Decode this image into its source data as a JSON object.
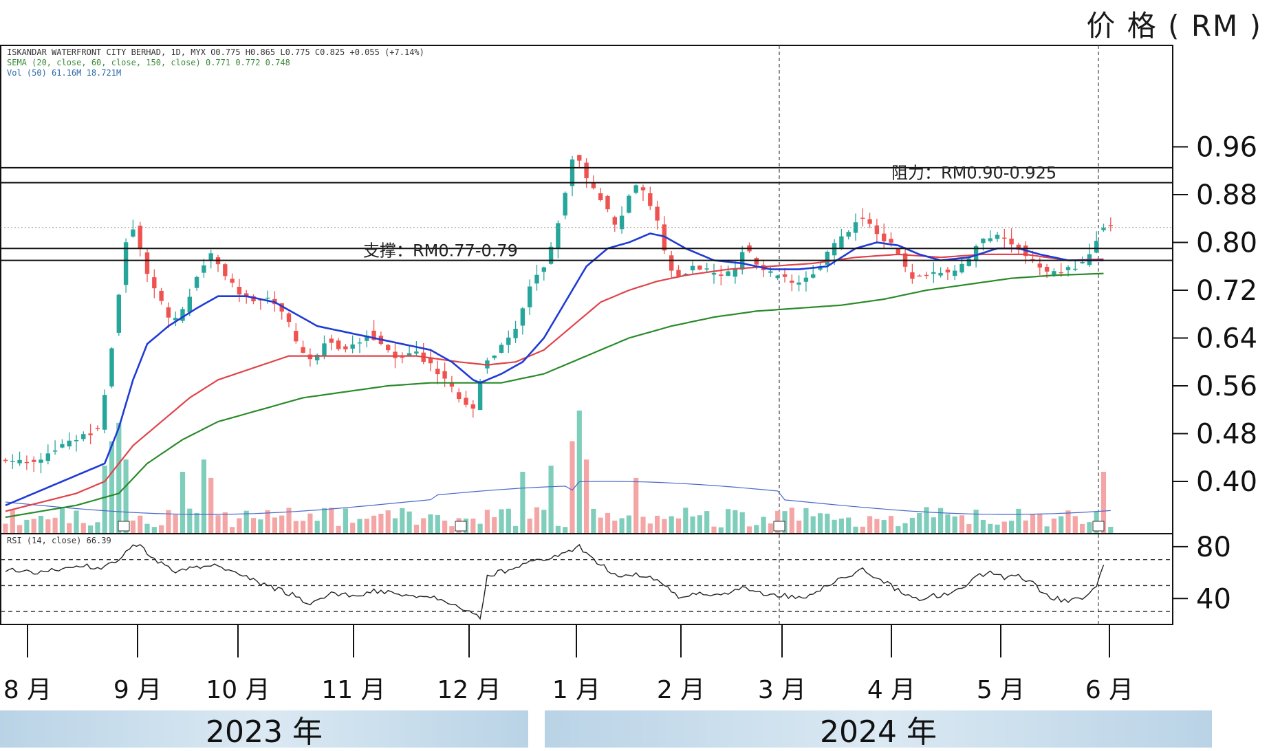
{
  "header": {
    "unit_title": "价 格 ( RM )"
  },
  "info": {
    "line1": "ISKANDAR WATERFRONT CITY BERHAD, 1D, MYX  O0.775  H0.865  L0.775  C0.825  +0.055 (+7.14%)",
    "line2": "SEMA (20, close, 60, close, 150, close)  0.771  0.772  0.748",
    "line3": "Vol (50)  61.16M  18.721M",
    "rsi_label": "RSI (14, close)  66.39"
  },
  "years": {
    "y2023": "2023 年",
    "y2024": "2024 年"
  },
  "colors": {
    "up": "#26a69a",
    "down": "#ef5350",
    "vol_up": "#7fcdbb",
    "vol_down": "#f4a6a6",
    "ema20": "#1f3bd6",
    "ema60": "#e0434a",
    "ema150": "#2a8a2a",
    "vol_ma": "#4a67c9",
    "rsi": "#222222"
  },
  "chart_data": {
    "type": "candlestick",
    "title": "ISKANDAR WATERFRONT CITY BERHAD",
    "ylabel": "价 格 ( RM )",
    "ylim": [
      0.34,
      0.995
    ],
    "yticks": [
      "0.40",
      "0.48",
      "0.56",
      "0.64",
      "0.72",
      "0.80",
      "0.88",
      "0.96"
    ],
    "months": [
      "8 月",
      "9 月",
      "10 月",
      "11 月",
      "12 月",
      "1 月",
      "2 月",
      "3 月",
      "4 月",
      "5 月",
      "6 月"
    ],
    "levels": [
      {
        "name": "resistance",
        "label": "阻力：RM0.90-0.925",
        "values": [
          0.925,
          0.9
        ]
      },
      {
        "name": "support",
        "label": "支撑：RM0.77-0.79",
        "values": [
          0.79,
          0.77
        ]
      }
    ],
    "close_dotted": 0.825,
    "price_path": [
      [
        0,
        0.44
      ],
      [
        3,
        0.43
      ],
      [
        6,
        0.44
      ],
      [
        10,
        0.47
      ],
      [
        12,
        0.48
      ],
      [
        14,
        0.49
      ],
      [
        15,
        0.58
      ],
      [
        16,
        0.66
      ],
      [
        17,
        0.75
      ],
      [
        18,
        0.83
      ],
      [
        19,
        0.82
      ],
      [
        20,
        0.77
      ],
      [
        21,
        0.73
      ],
      [
        22,
        0.71
      ],
      [
        23,
        0.69
      ],
      [
        24,
        0.66
      ],
      [
        26,
        0.69
      ],
      [
        27,
        0.73
      ],
      [
        28,
        0.76
      ],
      [
        30,
        0.78
      ],
      [
        32,
        0.74
      ],
      [
        34,
        0.71
      ],
      [
        36,
        0.7
      ],
      [
        38,
        0.71
      ],
      [
        40,
        0.68
      ],
      [
        42,
        0.62
      ],
      [
        44,
        0.6
      ],
      [
        46,
        0.64
      ],
      [
        48,
        0.62
      ],
      [
        50,
        0.63
      ],
      [
        52,
        0.65
      ],
      [
        54,
        0.62
      ],
      [
        56,
        0.61
      ],
      [
        58,
        0.62
      ],
      [
        60,
        0.6
      ],
      [
        62,
        0.58
      ],
      [
        64,
        0.55
      ],
      [
        66,
        0.53
      ],
      [
        67,
        0.52
      ],
      [
        68,
        0.6
      ],
      [
        70,
        0.62
      ],
      [
        72,
        0.64
      ],
      [
        74,
        0.7
      ],
      [
        75,
        0.74
      ],
      [
        77,
        0.77
      ],
      [
        78,
        0.8
      ],
      [
        79,
        0.85
      ],
      [
        80,
        0.91
      ],
      [
        81,
        0.96
      ],
      [
        82,
        0.93
      ],
      [
        83,
        0.9
      ],
      [
        85,
        0.87
      ],
      [
        86,
        0.84
      ],
      [
        87,
        0.82
      ],
      [
        88,
        0.86
      ],
      [
        89,
        0.89
      ],
      [
        90,
        0.9
      ],
      [
        91,
        0.88
      ],
      [
        92,
        0.85
      ],
      [
        93,
        0.83
      ],
      [
        94,
        0.76
      ],
      [
        96,
        0.74
      ],
      [
        98,
        0.76
      ],
      [
        100,
        0.75
      ],
      [
        102,
        0.74
      ],
      [
        104,
        0.76
      ],
      [
        105,
        0.8
      ],
      [
        106,
        0.77
      ],
      [
        108,
        0.75
      ],
      [
        110,
        0.74
      ],
      [
        112,
        0.73
      ],
      [
        114,
        0.74
      ],
      [
        116,
        0.77
      ],
      [
        118,
        0.8
      ],
      [
        120,
        0.82
      ],
      [
        121,
        0.85
      ],
      [
        122,
        0.84
      ],
      [
        123,
        0.82
      ],
      [
        125,
        0.8
      ],
      [
        127,
        0.78
      ],
      [
        128,
        0.74
      ],
      [
        130,
        0.74
      ],
      [
        132,
        0.75
      ],
      [
        134,
        0.75
      ],
      [
        136,
        0.76
      ],
      [
        138,
        0.8
      ],
      [
        140,
        0.81
      ],
      [
        142,
        0.8
      ],
      [
        144,
        0.79
      ],
      [
        146,
        0.76
      ],
      [
        148,
        0.75
      ],
      [
        150,
        0.75
      ],
      [
        152,
        0.76
      ],
      [
        154,
        0.78
      ],
      [
        155,
        0.825
      ]
    ],
    "ema20_path": [
      [
        0,
        0.36
      ],
      [
        8,
        0.4
      ],
      [
        12,
        0.42
      ],
      [
        14,
        0.43
      ],
      [
        16,
        0.49
      ],
      [
        18,
        0.57
      ],
      [
        20,
        0.63
      ],
      [
        23,
        0.66
      ],
      [
        27,
        0.69
      ],
      [
        30,
        0.71
      ],
      [
        34,
        0.71
      ],
      [
        38,
        0.7
      ],
      [
        41,
        0.68
      ],
      [
        44,
        0.66
      ],
      [
        48,
        0.65
      ],
      [
        52,
        0.64
      ],
      [
        56,
        0.63
      ],
      [
        60,
        0.62
      ],
      [
        63,
        0.6
      ],
      [
        66,
        0.57
      ],
      [
        67,
        0.565
      ],
      [
        70,
        0.58
      ],
      [
        73,
        0.6
      ],
      [
        76,
        0.64
      ],
      [
        79,
        0.7
      ],
      [
        82,
        0.76
      ],
      [
        85,
        0.79
      ],
      [
        88,
        0.8
      ],
      [
        91,
        0.815
      ],
      [
        93,
        0.81
      ],
      [
        96,
        0.79
      ],
      [
        100,
        0.77
      ],
      [
        104,
        0.765
      ],
      [
        108,
        0.755
      ],
      [
        112,
        0.755
      ],
      [
        116,
        0.76
      ],
      [
        120,
        0.79
      ],
      [
        123,
        0.8
      ],
      [
        126,
        0.795
      ],
      [
        129,
        0.78
      ],
      [
        132,
        0.77
      ],
      [
        136,
        0.775
      ],
      [
        140,
        0.79
      ],
      [
        143,
        0.79
      ],
      [
        146,
        0.78
      ],
      [
        150,
        0.77
      ],
      [
        155,
        0.77
      ]
    ],
    "ema60_path": [
      [
        0,
        0.35
      ],
      [
        10,
        0.38
      ],
      [
        14,
        0.4
      ],
      [
        18,
        0.46
      ],
      [
        22,
        0.5
      ],
      [
        26,
        0.54
      ],
      [
        30,
        0.57
      ],
      [
        35,
        0.59
      ],
      [
        40,
        0.61
      ],
      [
        46,
        0.61
      ],
      [
        52,
        0.61
      ],
      [
        58,
        0.61
      ],
      [
        64,
        0.6
      ],
      [
        68,
        0.595
      ],
      [
        72,
        0.6
      ],
      [
        76,
        0.62
      ],
      [
        80,
        0.66
      ],
      [
        84,
        0.7
      ],
      [
        88,
        0.72
      ],
      [
        92,
        0.735
      ],
      [
        96,
        0.745
      ],
      [
        102,
        0.755
      ],
      [
        108,
        0.76
      ],
      [
        114,
        0.765
      ],
      [
        120,
        0.775
      ],
      [
        126,
        0.78
      ],
      [
        132,
        0.775
      ],
      [
        138,
        0.78
      ],
      [
        144,
        0.78
      ],
      [
        150,
        0.77
      ],
      [
        155,
        0.772
      ]
    ],
    "ema150_path": [
      [
        0,
        0.34
      ],
      [
        10,
        0.36
      ],
      [
        16,
        0.38
      ],
      [
        20,
        0.43
      ],
      [
        25,
        0.47
      ],
      [
        30,
        0.5
      ],
      [
        36,
        0.52
      ],
      [
        42,
        0.54
      ],
      [
        48,
        0.55
      ],
      [
        54,
        0.56
      ],
      [
        60,
        0.565
      ],
      [
        66,
        0.565
      ],
      [
        70,
        0.565
      ],
      [
        76,
        0.58
      ],
      [
        82,
        0.61
      ],
      [
        88,
        0.64
      ],
      [
        94,
        0.66
      ],
      [
        100,
        0.675
      ],
      [
        106,
        0.685
      ],
      [
        112,
        0.69
      ],
      [
        118,
        0.695
      ],
      [
        124,
        0.705
      ],
      [
        130,
        0.72
      ],
      [
        136,
        0.73
      ],
      [
        142,
        0.74
      ],
      [
        148,
        0.745
      ],
      [
        155,
        0.748
      ]
    ],
    "volume_spikes": [
      [
        14,
        0.55
      ],
      [
        15,
        0.75
      ],
      [
        16,
        0.9
      ],
      [
        17,
        0.6
      ],
      [
        25,
        0.5
      ],
      [
        28,
        0.6
      ],
      [
        29,
        0.45
      ],
      [
        73,
        0.5
      ],
      [
        77,
        0.55
      ],
      [
        80,
        0.75
      ],
      [
        81,
        1.0
      ],
      [
        82,
        0.6
      ],
      [
        89,
        0.45
      ],
      [
        155,
        0.5
      ]
    ],
    "rsi_range": [
      20,
      90
    ],
    "rsi_ticks": [
      "80",
      "40"
    ],
    "rsi_levels": [
      70,
      50,
      30
    ],
    "rsi_path": [
      [
        0,
        62
      ],
      [
        5,
        60
      ],
      [
        10,
        66
      ],
      [
        14,
        64
      ],
      [
        16,
        70
      ],
      [
        18,
        82
      ],
      [
        19,
        80
      ],
      [
        21,
        70
      ],
      [
        24,
        60
      ],
      [
        27,
        64
      ],
      [
        30,
        66
      ],
      [
        33,
        58
      ],
      [
        36,
        52
      ],
      [
        40,
        44
      ],
      [
        43,
        36
      ],
      [
        46,
        44
      ],
      [
        49,
        42
      ],
      [
        52,
        46
      ],
      [
        55,
        44
      ],
      [
        58,
        42
      ],
      [
        61,
        40
      ],
      [
        64,
        34
      ],
      [
        66,
        30
      ],
      [
        67,
        26
      ],
      [
        68,
        58
      ],
      [
        71,
        62
      ],
      [
        74,
        68
      ],
      [
        77,
        72
      ],
      [
        79,
        74
      ],
      [
        80,
        78
      ],
      [
        81,
        80
      ],
      [
        83,
        70
      ],
      [
        85,
        62
      ],
      [
        87,
        56
      ],
      [
        89,
        58
      ],
      [
        91,
        56
      ],
      [
        93,
        50
      ],
      [
        95,
        40
      ],
      [
        98,
        44
      ],
      [
        101,
        42
      ],
      [
        104,
        48
      ],
      [
        107,
        44
      ],
      [
        110,
        42
      ],
      [
        113,
        40
      ],
      [
        115,
        46
      ],
      [
        117,
        54
      ],
      [
        119,
        58
      ],
      [
        121,
        62
      ],
      [
        123,
        56
      ],
      [
        125,
        50
      ],
      [
        127,
        42
      ],
      [
        129,
        38
      ],
      [
        131,
        42
      ],
      [
        133,
        44
      ],
      [
        135,
        48
      ],
      [
        137,
        58
      ],
      [
        139,
        60
      ],
      [
        141,
        56
      ],
      [
        143,
        58
      ],
      [
        145,
        52
      ],
      [
        147,
        42
      ],
      [
        150,
        38
      ],
      [
        152,
        40
      ],
      [
        154,
        50
      ],
      [
        155,
        66
      ]
    ]
  }
}
